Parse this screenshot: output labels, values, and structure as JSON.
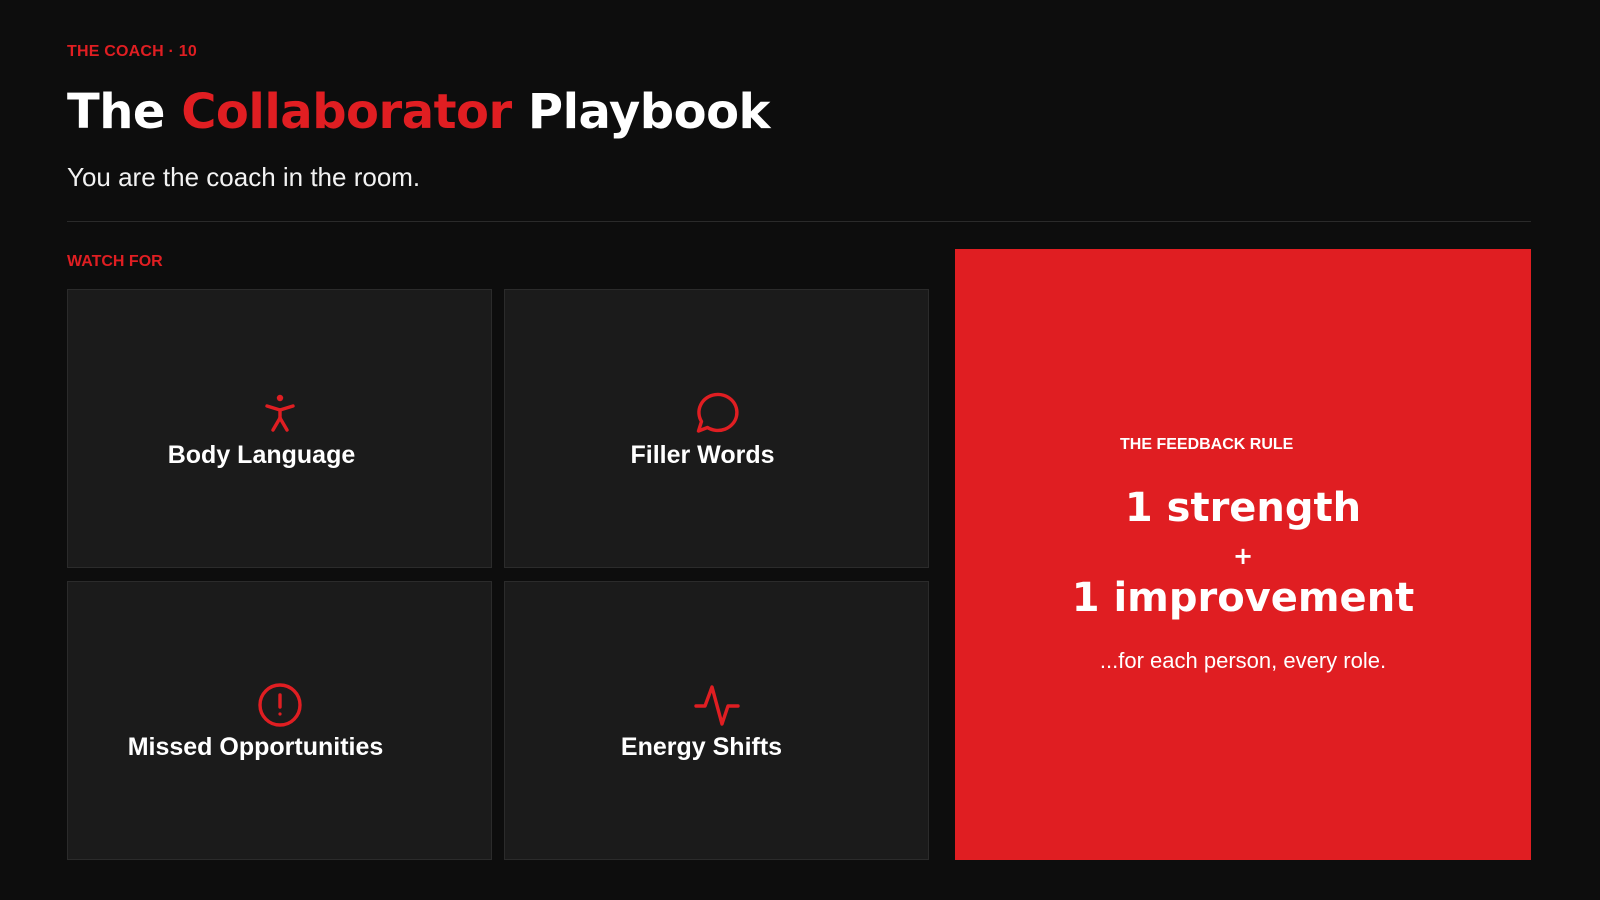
{
  "header": {
    "eyebrow": "THE COACH · 10",
    "title_pre": "The ",
    "title_accent": "Collaborator",
    "title_post": " Playbook",
    "subtitle": "You are the coach in the room."
  },
  "watch": {
    "section_label": "WATCH FOR",
    "items": [
      {
        "label": "Body Language",
        "icon": "person-icon"
      },
      {
        "label": "Filler Words",
        "icon": "speech-bubble-icon"
      },
      {
        "label": "Missed Opportunities",
        "icon": "alert-circle-icon"
      },
      {
        "label": "Energy Shifts",
        "icon": "pulse-icon"
      }
    ]
  },
  "feedback_rule": {
    "eyebrow": "THE FEEDBACK RULE",
    "line1": "1 strength",
    "plus": "+",
    "line2": "1 improvement",
    "note": "...for each person, every role."
  },
  "colors": {
    "accent": "#e01e22",
    "background": "#0d0d0d",
    "card": "#1b1b1b",
    "text": "#ffffff"
  }
}
